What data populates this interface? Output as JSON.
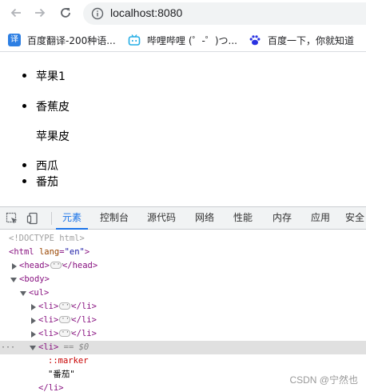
{
  "browser": {
    "url": "localhost:8080",
    "bookmarks": [
      {
        "label": "百度翻译-200种语...",
        "favicon": "fanyi",
        "favicon_text": "译"
      },
      {
        "label": "哔哩哔哩 (゜-゜)つ...",
        "favicon": "bilibili-tv-icon"
      },
      {
        "label": "百度一下，你就知道",
        "favicon": "baidu-paw-icon"
      }
    ]
  },
  "page": {
    "items": [
      {
        "text": "苹果1",
        "bullet": true
      },
      {
        "text": "香蕉皮",
        "bullet": true
      },
      {
        "text": "苹果皮",
        "bullet": false
      },
      {
        "text": "西瓜",
        "bullet": true
      },
      {
        "text": "番茄",
        "bullet": true
      }
    ]
  },
  "devtools": {
    "tabs": [
      "元素",
      "控制台",
      "源代码",
      "网络",
      "性能",
      "内存",
      "应用",
      "安全"
    ],
    "active_tab": "元素",
    "dom": {
      "doctype": "<!DOCTYPE html>",
      "html_open": "<html",
      "html_attr": "lang",
      "html_attr_val": "\"en\"",
      "head_open": "<head>",
      "head_close": "</head>",
      "body_open": "<body>",
      "ul_open": "<ul>",
      "li_open": "<li>",
      "li_close": "</li>",
      "selected_marker": "== $0",
      "pseudo": "::marker",
      "text_node": "\"番茄\"",
      "gutter": "···"
    }
  },
  "watermark": "CSDN @宁然也",
  "colors": {
    "accent": "#1a73e8",
    "tag": "#881280",
    "attr": "#994500",
    "value": "#1a1aa6"
  }
}
